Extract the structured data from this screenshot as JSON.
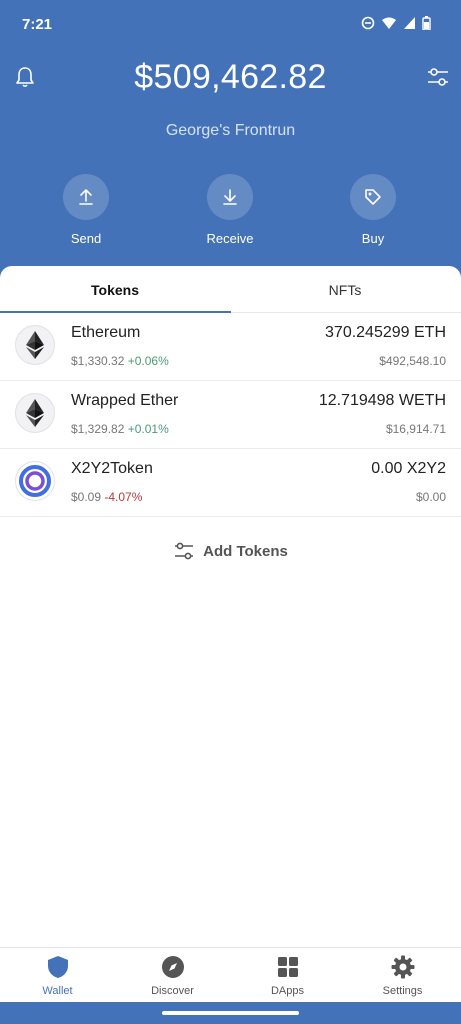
{
  "status_bar": {
    "time": "7:21"
  },
  "header": {
    "balance": "$509,462.82",
    "wallet_name": "George's Frontrun",
    "actions": [
      {
        "label": "Send",
        "icon": "upload-arrow-icon"
      },
      {
        "label": "Receive",
        "icon": "download-arrow-icon"
      },
      {
        "label": "Buy",
        "icon": "tag-icon"
      }
    ]
  },
  "tabs": [
    {
      "label": "Tokens",
      "active": true
    },
    {
      "label": "NFTs",
      "active": false
    }
  ],
  "tokens": [
    {
      "name": "Ethereum",
      "price": "$1,330.32",
      "change": "+0.06%",
      "amount": "370.245299 ETH",
      "fiat": "$492,548.10",
      "icon": "ethereum-icon"
    },
    {
      "name": "Wrapped Ether",
      "price": "$1,329.82",
      "change": "+0.01%",
      "amount": "12.719498 WETH",
      "fiat": "$16,914.71",
      "icon": "ethereum-icon"
    },
    {
      "name": "X2Y2Token",
      "price": "$0.09",
      "change": "-4.07%",
      "amount": "0.00 X2Y2",
      "fiat": "$0.00",
      "icon": "x2y2-ring-icon"
    }
  ],
  "add_tokens_label": "Add Tokens",
  "bottom_nav": [
    {
      "label": "Wallet",
      "icon": "shield-icon",
      "active": true
    },
    {
      "label": "Discover",
      "icon": "compass-icon",
      "active": false
    },
    {
      "label": "DApps",
      "icon": "grid-icon",
      "active": false
    },
    {
      "label": "Settings",
      "icon": "gear-icon",
      "active": false
    }
  ],
  "colors": {
    "brand_blue": "#4472b8",
    "positive": "#4a9a7a",
    "negative": "#b53a3a"
  }
}
